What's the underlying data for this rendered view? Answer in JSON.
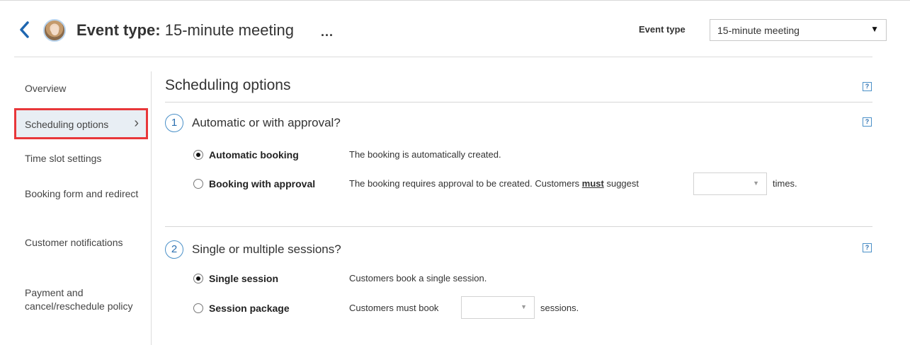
{
  "header": {
    "back_icon": "chevron-left-icon",
    "title_label": "Event type:",
    "title_value": "15-minute meeting",
    "more_icon": "...",
    "event_type_label": "Event type",
    "event_type_selected": "15-minute meeting"
  },
  "sidebar": {
    "items": [
      {
        "label": "Overview"
      },
      {
        "label": "Scheduling options",
        "active": true
      },
      {
        "label": "Time slot settings"
      },
      {
        "label": "Booking form and redirect"
      },
      {
        "label": "Customer notifications"
      },
      {
        "label": "Payment and cancel/reschedule policy"
      }
    ]
  },
  "main": {
    "section_title": "Scheduling options",
    "help": "?",
    "step1": {
      "number": "1",
      "title": "Automatic or with approval?",
      "options": [
        {
          "label": "Automatic booking",
          "checked": true,
          "desc": "The booking is automatically created."
        },
        {
          "label": "Booking with approval",
          "checked": false,
          "desc_before": "The booking requires approval to be created. Customers ",
          "desc_emph": "must",
          "desc_mid": " suggest",
          "select_value": "",
          "desc_after": "times."
        }
      ]
    },
    "step2": {
      "number": "2",
      "title": "Single or multiple sessions?",
      "options": [
        {
          "label": "Single session",
          "checked": true,
          "desc": "Customers book a single session."
        },
        {
          "label": "Session package",
          "checked": false,
          "desc_before": "Customers must book",
          "select_value": "",
          "desc_after": "sessions."
        }
      ]
    }
  },
  "colors": {
    "accent_blue": "#2b6fb0",
    "highlight_red": "#e8373a",
    "active_bg": "#e8eef4"
  }
}
